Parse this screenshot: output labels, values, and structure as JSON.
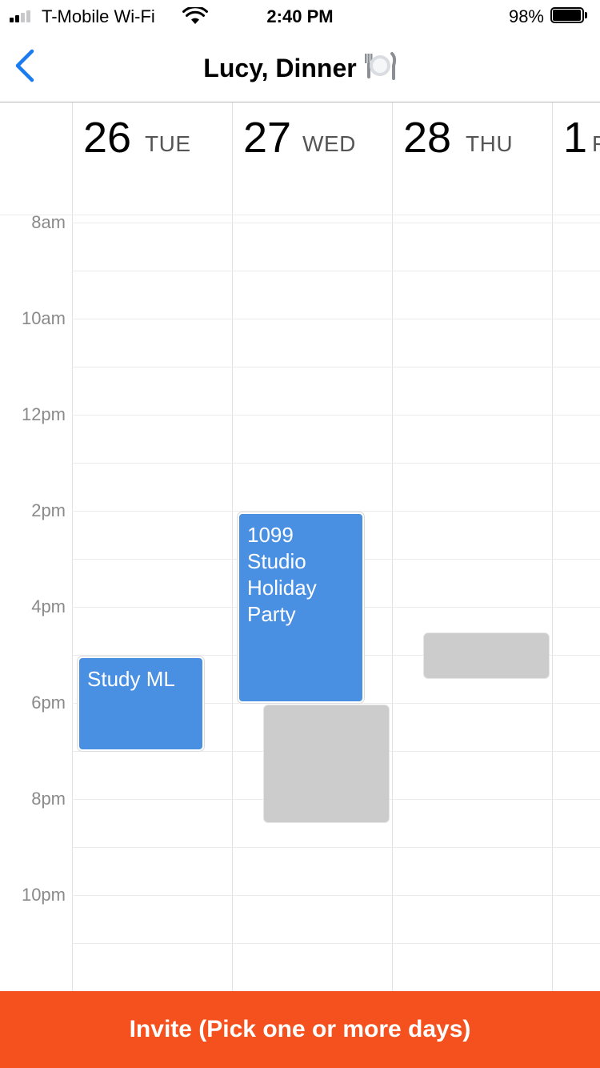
{
  "status_bar": {
    "carrier": "T-Mobile Wi-Fi",
    "time": "2:40 PM",
    "battery": "98%",
    "battery_level": 0.98,
    "signal_bars": 2
  },
  "nav": {
    "title": "Lucy, Dinner",
    "title_icon": "plate-with-cutlery-icon",
    "back_icon": "chevron-left-icon",
    "accent_color": "#1a7cf0"
  },
  "calendar": {
    "days": [
      {
        "num": "26",
        "dow": "TUE"
      },
      {
        "num": "27",
        "dow": "WED"
      },
      {
        "num": "28",
        "dow": "THU"
      },
      {
        "num": "1",
        "dow": "F"
      }
    ],
    "time_labels": [
      "8am",
      "10am",
      "12pm",
      "2pm",
      "4pm",
      "6pm",
      "8pm",
      "10pm"
    ],
    "events": [
      {
        "title": "Study ML",
        "day": "26",
        "start": "5pm",
        "end": "7pm",
        "kind": "own"
      },
      {
        "title": "1099 Studio Holiday Party",
        "day": "27",
        "start": "2pm",
        "end": "6pm",
        "kind": "own"
      },
      {
        "title": "",
        "day": "27",
        "start": "6pm",
        "end": "8:30pm",
        "kind": "busy"
      },
      {
        "title": "",
        "day": "28",
        "start": "4:30pm",
        "end": "5:30pm",
        "kind": "busy"
      }
    ],
    "event_color": "#4a90e2",
    "busy_color": "#cccccc"
  },
  "invite": {
    "label": "Invite (Pick one or more days)",
    "color": "#f4511e"
  }
}
